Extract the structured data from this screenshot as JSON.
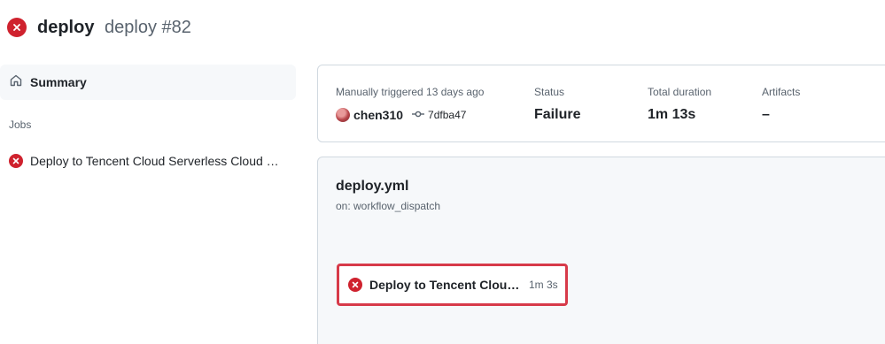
{
  "header": {
    "workflow_name": "deploy",
    "run_title": "deploy #82",
    "status_icon": "x-circle-fill-icon"
  },
  "sidebar": {
    "summary_label": "Summary",
    "summary_icon": "home-icon",
    "jobs_heading": "Jobs",
    "jobs": [
      {
        "label": "Deploy to Tencent Cloud Serverless Cloud F...",
        "status": "failure"
      }
    ]
  },
  "run_summary": {
    "trigger_text": "Manually triggered 13 days ago",
    "actor": "chen310",
    "commit": "7dfba47",
    "status_label": "Status",
    "status_value": "Failure",
    "duration_label": "Total duration",
    "duration_value": "1m 13s",
    "artifacts_label": "Artifacts",
    "artifacts_value": "–"
  },
  "graph": {
    "workflow_file": "deploy.yml",
    "trigger": "on: workflow_dispatch",
    "jobs": [
      {
        "label": "Deploy to Tencent Cloud ...",
        "duration": "1m 3s",
        "status": "failure"
      }
    ]
  },
  "colors": {
    "failure": "#cf222e",
    "node_border": "#d73a49",
    "muted_text": "#59636e",
    "border": "#d1d9e0",
    "panel_bg": "#f6f8fa"
  }
}
